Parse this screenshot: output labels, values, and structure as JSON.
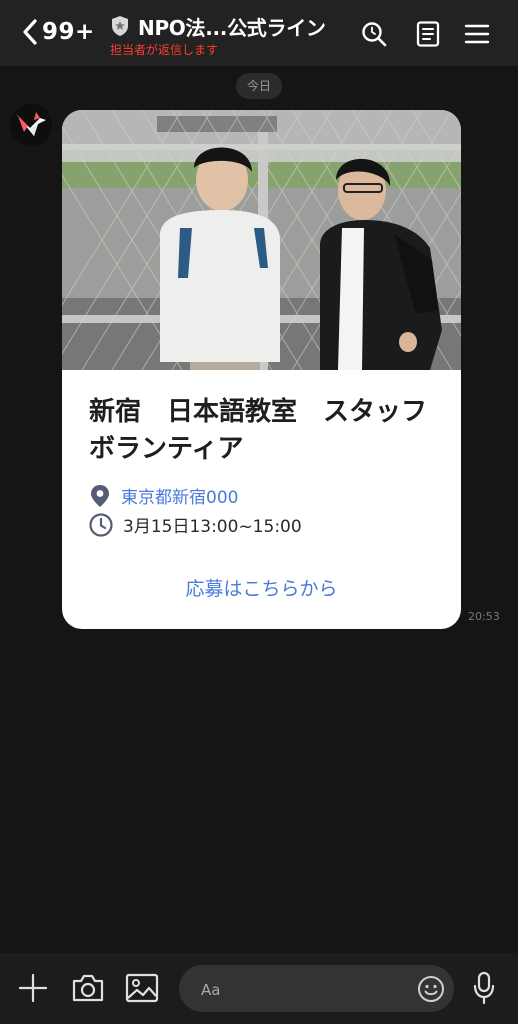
{
  "header": {
    "unread_count": "99+",
    "title": "NPO法...公式ライン",
    "subtitle": "担当者が返信します"
  },
  "chat": {
    "date_label": "今日",
    "timestamp": "20:53",
    "card": {
      "title": "新宿　日本語教室　スタッフボランティア",
      "location": "東京都新宿000",
      "datetime": "3月15日13:00~15:00",
      "action_label": "応募はこちらから"
    }
  },
  "composer": {
    "placeholder": "Aa"
  },
  "colors": {
    "background": "#151515",
    "header": "#222222",
    "link_blue": "#4a7bd8",
    "subtitle_red": "#ff3b30",
    "card_bg": "#ffffff"
  },
  "icons": {
    "back": "chevron-left-icon",
    "official": "shield-star-icon",
    "search": "search-icon",
    "notes": "notes-icon",
    "menu": "menu-icon",
    "location": "location-pin-icon",
    "time": "clock-icon",
    "plus": "plus-icon",
    "camera": "camera-icon",
    "image": "image-icon",
    "emoji": "emoji-icon",
    "mic": "mic-icon"
  }
}
